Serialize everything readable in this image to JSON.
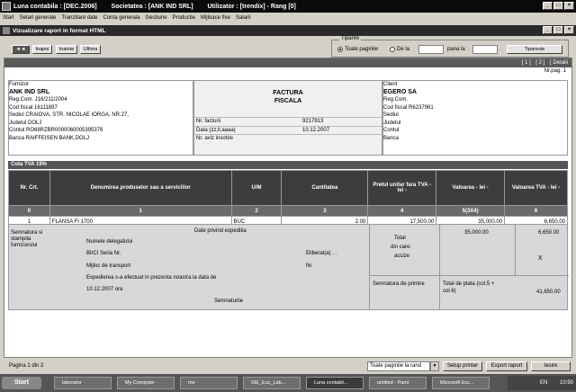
{
  "app": {
    "title_parts": [
      "Luna contabila : [DEC.2006]",
      "Societatea : [ANK IND SRL]",
      "Utilizator : [trendix] - Rang [0]"
    ]
  },
  "menu": [
    "Start",
    "Setari generale",
    "Tranzitare date",
    "Conta generala",
    "Gestiune",
    "Productie",
    "Mijloace fixe",
    "Salarii"
  ],
  "subwindow": {
    "title": "Vizualizare raport in format HTML"
  },
  "nav": {
    "back": "Inapoi",
    "next": "Inainte",
    "last": "Ultima"
  },
  "print_group": {
    "legend": "Tiparire",
    "all_pages": "Toate paginile",
    "from": "De la",
    "to": "pana la",
    "print_button": "Tipareste"
  },
  "report": {
    "nav_links": [
      "[ 1 ]",
      "[ 2 ]",
      "[ Detalii"
    ],
    "page_label": "Nr.pag: 1",
    "supplier": {
      "label": "Furnizor",
      "name": "ANK IND SRL",
      "reg": "Reg.Com. J16/211/2004",
      "cf": "Cod fiscal 16111897",
      "address": "Sediul CRAIOVA, STR. NICOLAE IORGA, NR.27,",
      "county": "Judetul DOLJ",
      "account": "Contul RO68RZBR0000060005395376",
      "bank": "Banca RAIFFEISEN BANK,DOLJ"
    },
    "invoice": {
      "title1": "FACTURA",
      "title2": "FISCALA",
      "rows": [
        {
          "label": "Nr. facturii",
          "value": "9217913"
        },
        {
          "label": "Data (zz,ll,aaaa)",
          "value": "10.12.2007"
        },
        {
          "label": "Nr. aviz insotire",
          "value": ""
        }
      ]
    },
    "client": {
      "label": "Client",
      "name": "EGERO SA",
      "reg": "Reg.Com.",
      "cf": "Cod fiscal R6237961",
      "seat": "Sediul",
      "county": "Judetul",
      "account": "Contul",
      "bank": "Banca"
    },
    "vat_rate": "Cota TVA 19%",
    "table": {
      "headers": [
        "Nr. Crt.",
        "Denumirea produselor sau a serviciilor",
        "U/M",
        "Cantitatea",
        "Pretul unitar fara TVA - lei -",
        "Valoarea - lei -",
        "Valoarea TVA - lei -"
      ],
      "indices": [
        "0",
        "1",
        "2",
        "3",
        "4",
        "5(3X4)",
        "6"
      ],
      "rows": [
        {
          "nr": "1",
          "name": "FLANSA FI 1700",
          "um": "BUC",
          "qty": "2.00",
          "price": "17,500.00",
          "value": "35,000.00",
          "vat": "6,650.00"
        }
      ]
    },
    "footer": {
      "sig_label": "Semnatura si stampila furnizorului",
      "exp_title": "Date privind expeditia",
      "delegate": "Numele delegatului",
      "id": "BI/CI Seria Nr.",
      "issued": "Eliberat(a) . .",
      "transport": "Mijloc de transport",
      "nr": "Nr.",
      "dispatch": "Expedierea s-a efectuat in prezenta noastra la data de",
      "datetime": "10.12.2007 ora",
      "signatures": "Semnaturile",
      "total": "Total",
      "of_which": "din care:",
      "excise": "accize",
      "total_value": "35,000.00",
      "total_vat": "6,650.00",
      "x_mark": "X",
      "receipt_sig": "Semnatura de primire",
      "pay_label": "Total de plata (col.5 + col.6)",
      "pay_value": "41,650.00"
    }
  },
  "status": {
    "page": "Pagina 1 din 2",
    "mode": "Toate paginile la rand",
    "setup": "Setup printer",
    "export": "Export raport",
    "exit": "Iesire"
  },
  "taskbar": {
    "start": "Start",
    "tasks": [
      "laborator",
      "My Computer",
      "me",
      "SIE_Euc_Lab...",
      "Luna contabil...",
      "untitled - Paint",
      "Microsoft Exc..."
    ],
    "lang": "EN",
    "time": "10:50"
  }
}
